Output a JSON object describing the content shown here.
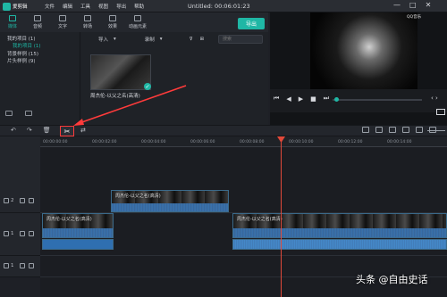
{
  "app": {
    "logo_text": "爱剪辑",
    "title": "Untitled: 00:06:01:23",
    "menus": [
      "文件",
      "编辑",
      "工具",
      "视图",
      "导出",
      "帮助"
    ],
    "window_controls": [
      "—",
      "□",
      "✕"
    ]
  },
  "tabs": [
    {
      "label": "媒体",
      "active": true
    },
    {
      "label": "音频",
      "active": false
    },
    {
      "label": "文字",
      "active": false
    },
    {
      "label": "转场",
      "active": false
    },
    {
      "label": "效果",
      "active": false
    },
    {
      "label": "动画元素",
      "active": false
    }
  ],
  "export_label": "导出",
  "sidebar": {
    "items": [
      {
        "label": "我的项目 (1)",
        "sub": false
      },
      {
        "label": "我的项目 (1)",
        "sub": true
      },
      {
        "label": "背景样例 (15)",
        "sub": false
      },
      {
        "label": "片头样例 (9)",
        "sub": false
      }
    ]
  },
  "mediabar": {
    "import_label": "导入",
    "record_label": "录制",
    "search_placeholder": "搜索"
  },
  "clip_label": "周杰伦-以父之名(高清)",
  "preview_watermark": "QQ音乐",
  "timeline": {
    "ticks": [
      "00:00:00:00",
      "00:00:02:00",
      "00:00:04:00",
      "00:00:06:00",
      "00:00:08:00",
      "00:00:10:00",
      "00:00:12:00",
      "00:00:14:00"
    ],
    "track_labels": [
      "2",
      "1",
      "1"
    ],
    "clip_titles": [
      "周杰伦-以父之名(高清)",
      "周杰伦-以父之名(高清)",
      "周杰伦-以父之名(高清)"
    ]
  },
  "brand_watermark": "头条 @自由史话",
  "colors": {
    "accent": "#1fb7a5",
    "playhead": "#e0493a",
    "annotation": "#ff3b3b"
  }
}
